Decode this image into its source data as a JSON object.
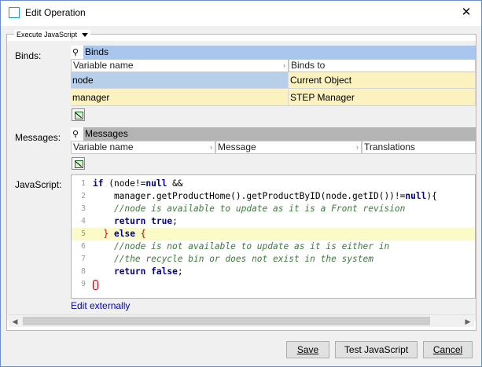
{
  "window": {
    "title": "Edit Operation",
    "close_glyph": "✕"
  },
  "panel": {
    "header": "Execute JavaScript"
  },
  "binds": {
    "label": "Binds:",
    "table_title": "Binds",
    "columns": [
      "Variable name",
      "Binds to"
    ],
    "rows": [
      {
        "variable": "node",
        "binds_to": "Current Object"
      },
      {
        "variable": "manager",
        "binds_to": "STEP Manager"
      }
    ]
  },
  "messages": {
    "label": "Messages:",
    "table_title": "Messages",
    "columns": [
      "Variable name",
      "Message",
      "Translations"
    ]
  },
  "javascript": {
    "label": "JavaScript:",
    "edit_externally": "Edit externally",
    "line_numbers": [
      "1",
      "2",
      "3",
      "4",
      "5",
      "6",
      "7",
      "8",
      "9"
    ],
    "highlighted_line": 5
  },
  "buttons": {
    "save": "Save",
    "test": "Test JavaScript",
    "cancel": "Cancel"
  },
  "colors": {
    "selected_row": "#b8cfea",
    "bound_row": "#fbf2c0",
    "header_blue": "#a9c6ec",
    "header_gray": "#b4b4b4"
  },
  "icons": {
    "pin": "pin-icon",
    "edit": "edit-table-icon",
    "window": "window-icon"
  }
}
